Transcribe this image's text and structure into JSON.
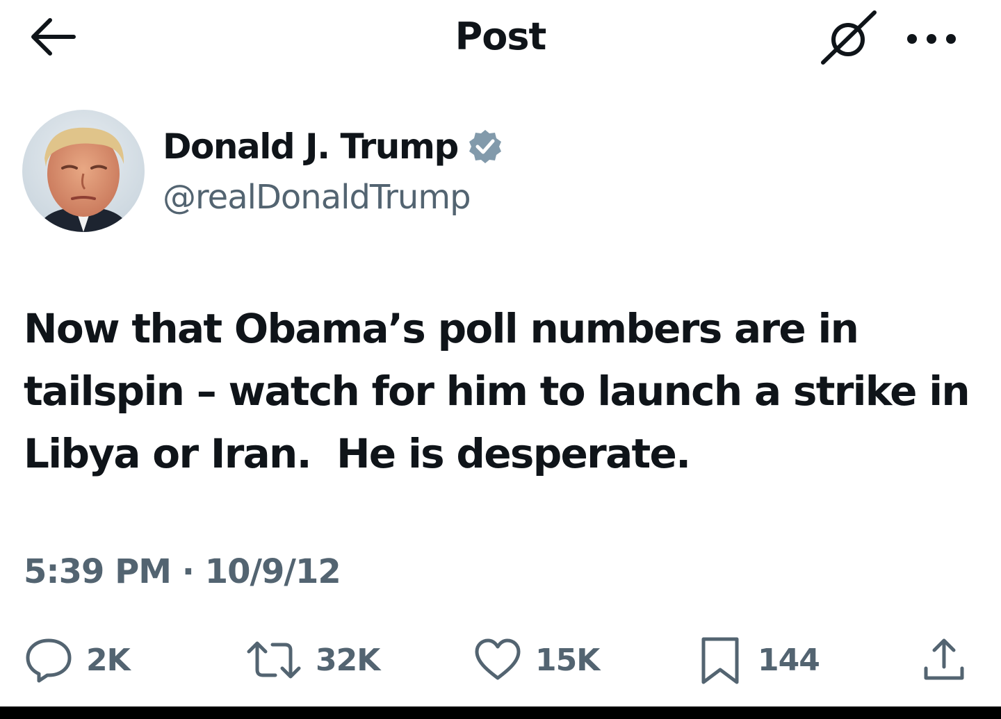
{
  "header": {
    "title": "Post",
    "back_icon": "arrow-left-icon",
    "grok_icon": "grok-icon",
    "more_icon": "more-horizontal-icon"
  },
  "author": {
    "display_name": "Donald J. Trump",
    "handle": "@realDonaldTrump",
    "verified": true,
    "verified_color": "#829aab"
  },
  "post": {
    "text": "Now that Obama’s poll numbers are in\ntailspin – watch for him to launch a strike in\nLibya or Iran.  He is desperate.",
    "timestamp": "5:39 PM · 10/9/12"
  },
  "actions": {
    "replies": {
      "icon": "reply-icon",
      "count": "2K"
    },
    "reposts": {
      "icon": "repost-icon",
      "count": "32K"
    },
    "likes": {
      "icon": "heart-icon",
      "count": "15K"
    },
    "bookmarks": {
      "icon": "bookmark-icon",
      "count": "144"
    },
    "share": {
      "icon": "share-icon"
    }
  },
  "colors": {
    "text_primary": "#0f1419",
    "text_secondary": "#536471",
    "background": "#ffffff"
  }
}
